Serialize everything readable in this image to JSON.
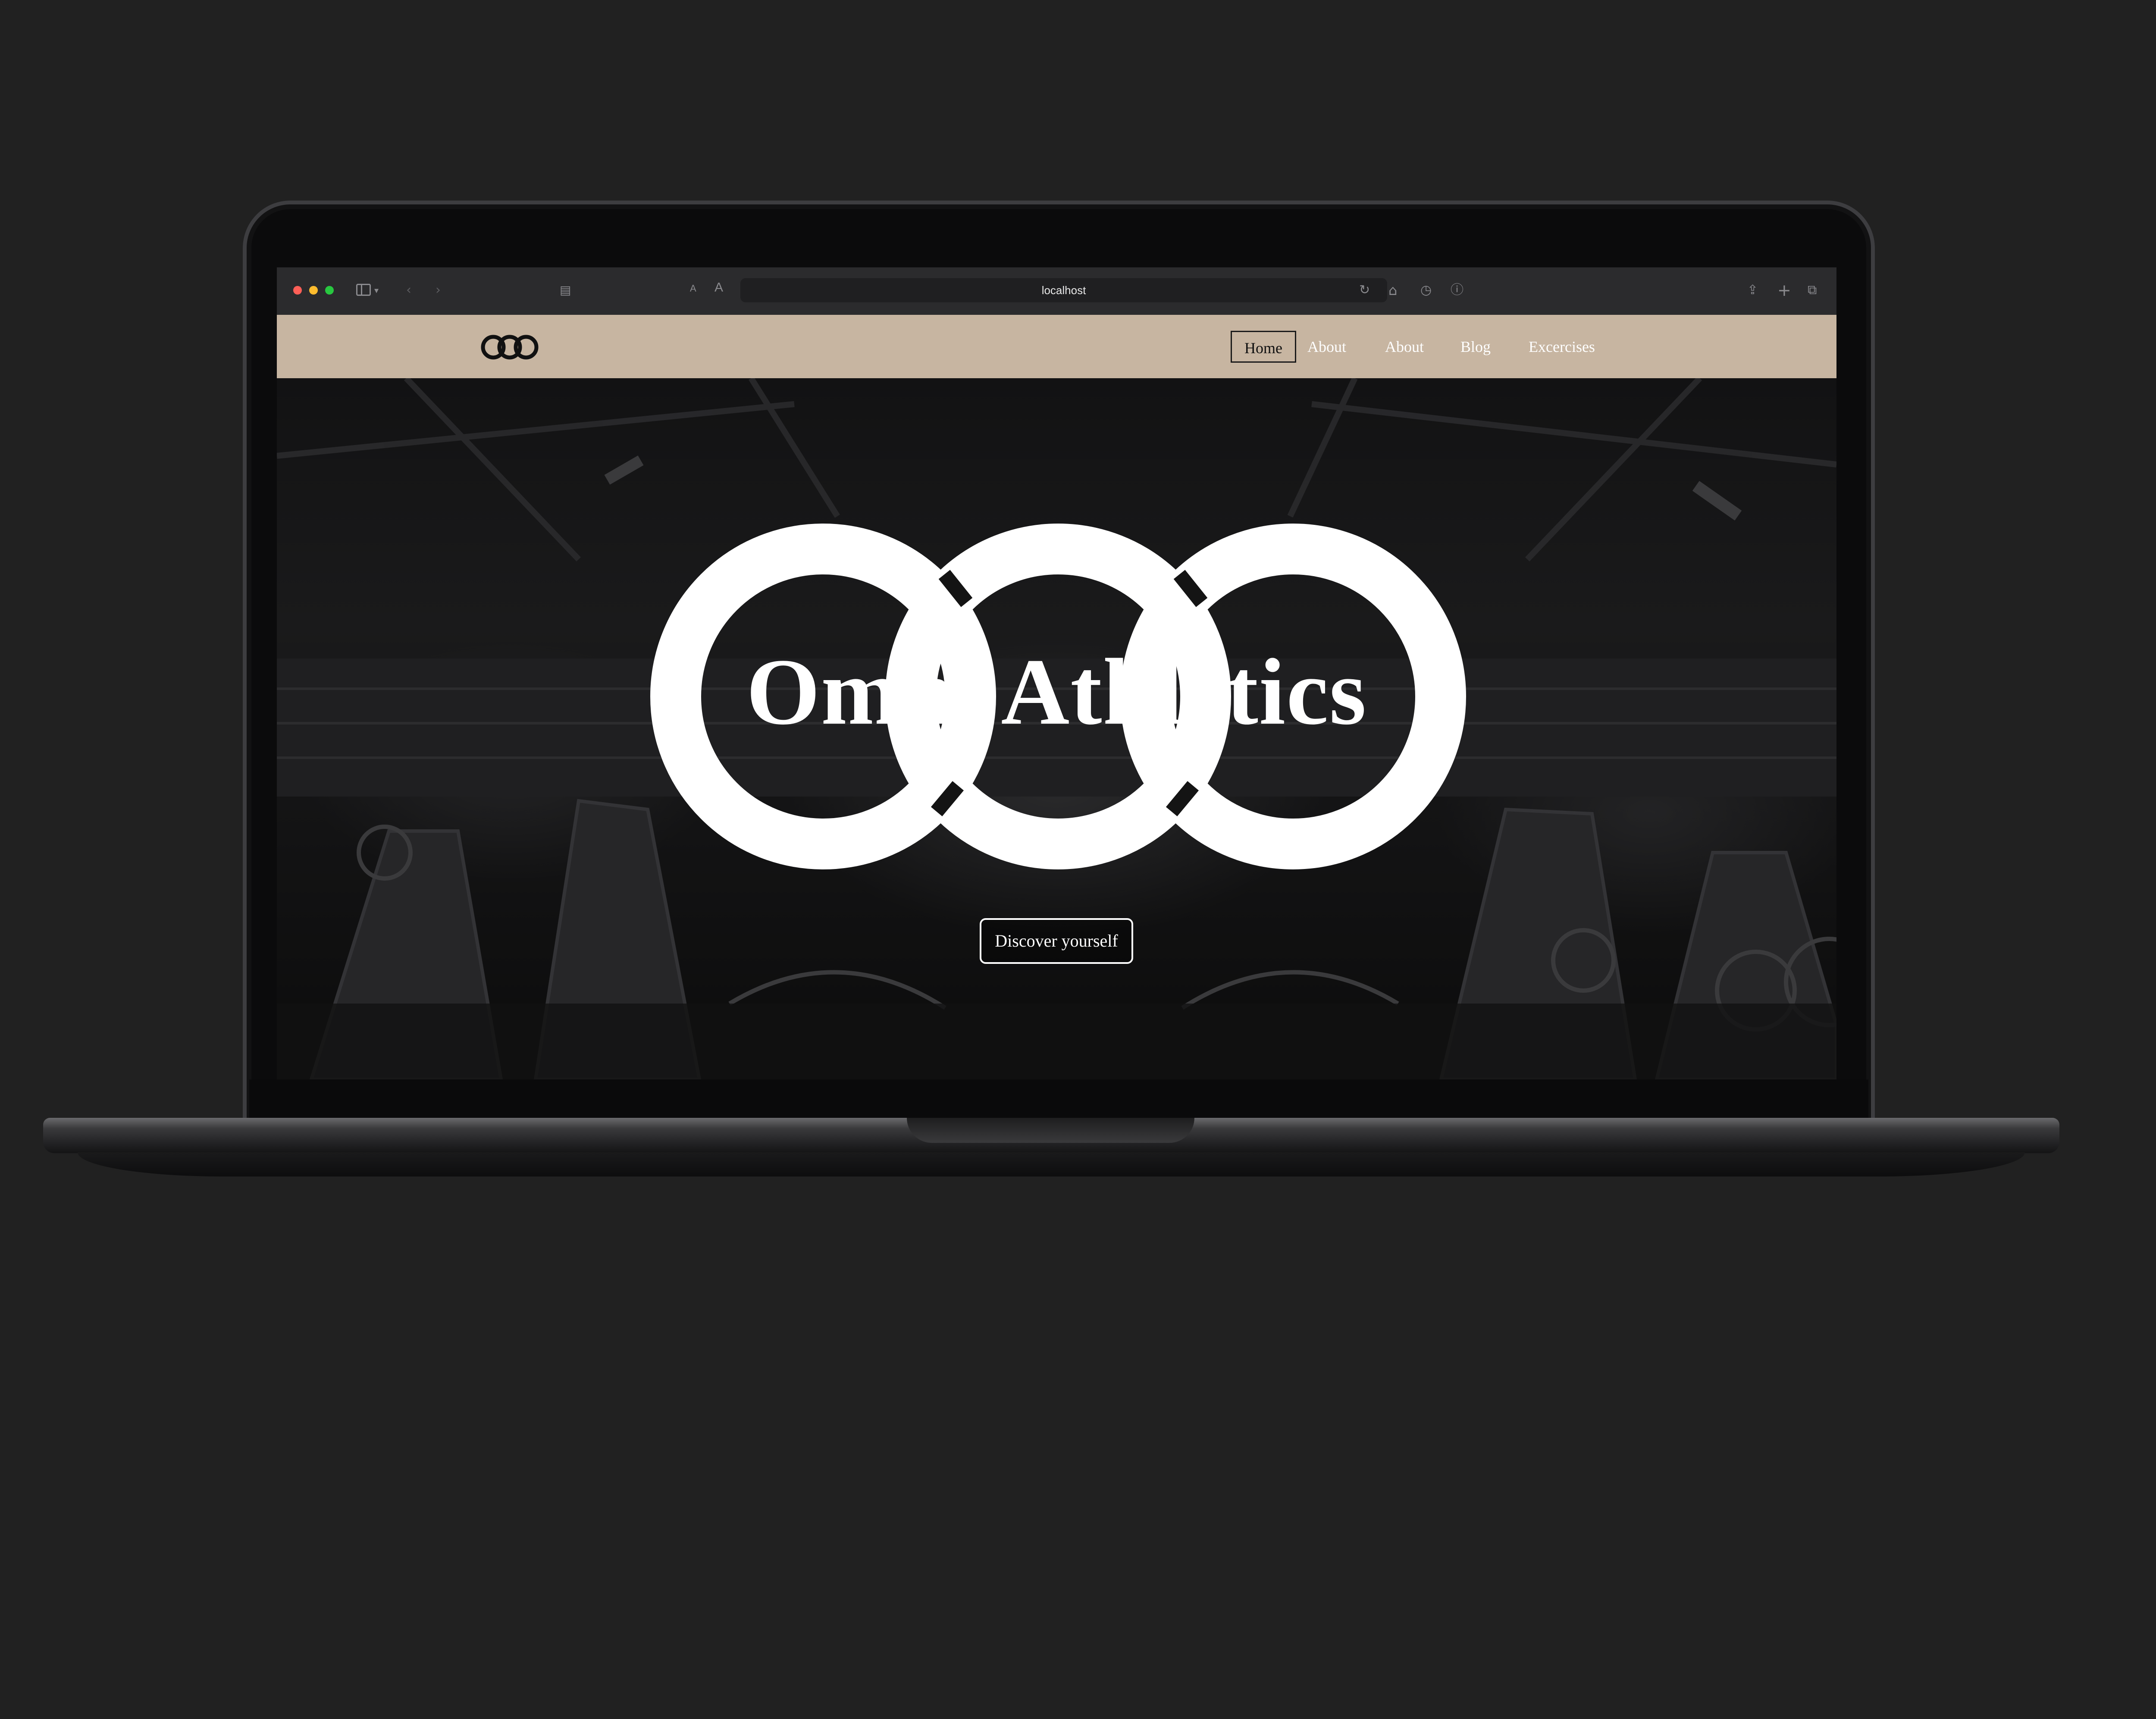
{
  "browser": {
    "url": "localhost",
    "font_small": "A",
    "font_large": "A"
  },
  "nav": {
    "items": [
      {
        "label": "Home",
        "active": true
      },
      {
        "label": "About",
        "active": false
      },
      {
        "label": "About",
        "active": false
      },
      {
        "label": "Blog",
        "active": false
      },
      {
        "label": "Excercises",
        "active": false
      }
    ]
  },
  "hero": {
    "title": "Omni Athletics",
    "cta_label": "Discover yourself"
  },
  "colors": {
    "nav_background": "#c7b5a1",
    "page_background": "#212121",
    "text": "#ffffff"
  },
  "icons": [
    "sidebar-icon",
    "chevron-left-icon",
    "chevron-right-icon",
    "tab-icon",
    "reload-icon",
    "home-icon",
    "history-icon",
    "info-icon",
    "share-icon",
    "plus-icon",
    "tabs-overview-icon",
    "logo-rings-icon"
  ]
}
